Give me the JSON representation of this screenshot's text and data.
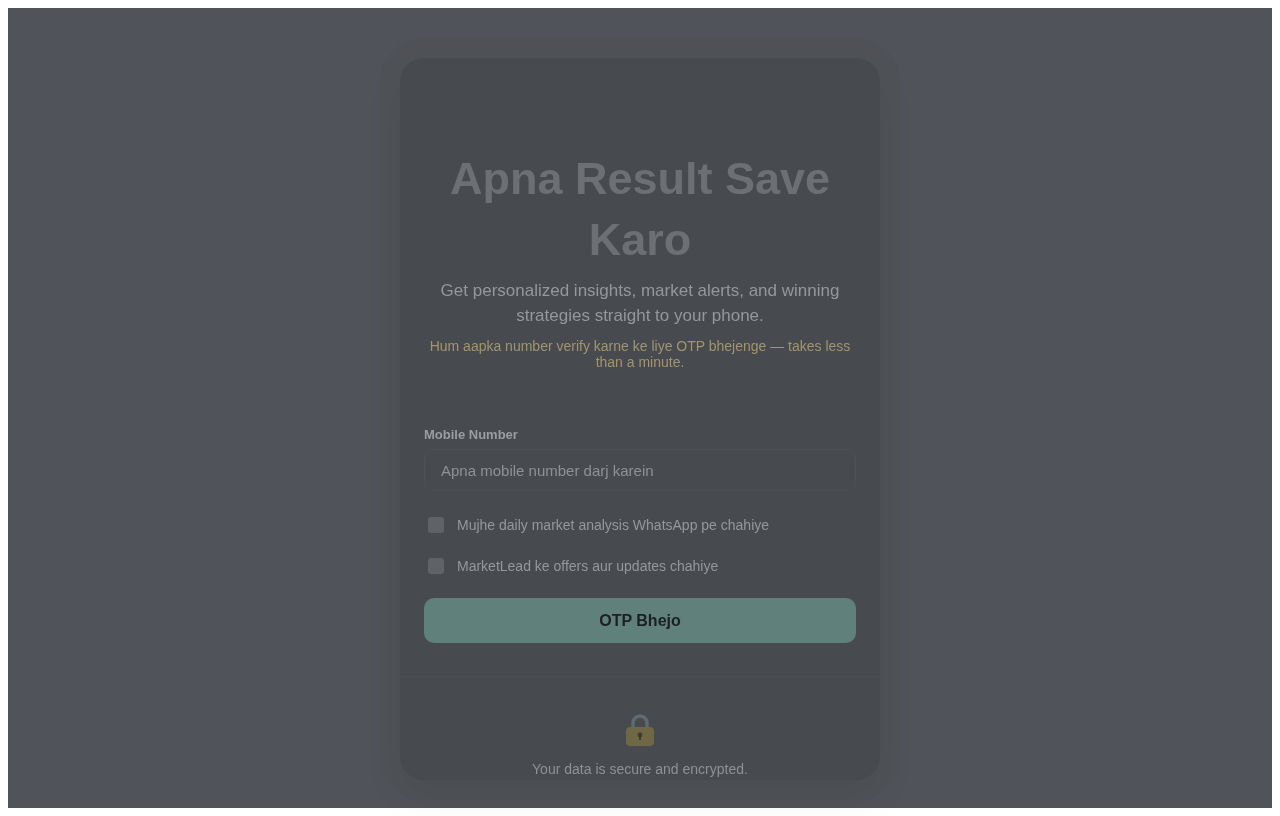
{
  "card": {
    "title": "Apna Result Save Karo",
    "subtitle": "Get personalized insights, market alerts, and winning strategies straight to your phone.",
    "note": "Hum aapka number verify karne ke liye OTP bhejenge — takes less than a minute."
  },
  "form": {
    "mobile_field": {
      "label": "Mobile Number",
      "placeholder": "Apna mobile number darj karein"
    },
    "consents": [
      {
        "label": "Mujhe daily market analysis WhatsApp pe chahiye",
        "checked": false
      },
      {
        "label": "MarketLead ke offers aur updates chahiye",
        "checked": false
      }
    ],
    "submit_button": "OTP Bhejo"
  },
  "footer": {
    "text": "Your data is secure and encrypted."
  }
}
